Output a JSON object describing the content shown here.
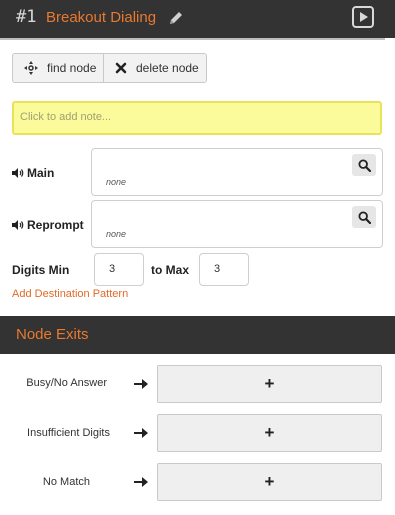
{
  "header": {
    "node_number": "#1",
    "node_title": "Breakout Dialing",
    "edit_icon": "pencil-icon",
    "play_icon": "play-icon"
  },
  "toolbar": {
    "find_label": "find node",
    "delete_label": "delete node",
    "find_icon": "crosshair-icon",
    "delete_icon": "x-icon"
  },
  "note": {
    "placeholder": "Click to add note..."
  },
  "prompts": {
    "main": {
      "label": "Main",
      "value": "none"
    },
    "reprompt": {
      "label": "Reprompt",
      "value": "none"
    }
  },
  "digits": {
    "min_label": "Digits Min",
    "min_value": "3",
    "max_label": "to Max",
    "max_value": "3",
    "add_pattern_label": "Add Destination Pattern"
  },
  "exits": {
    "title": "Node Exits",
    "items": [
      {
        "label": "Busy/No Answer",
        "action": "+"
      },
      {
        "label": "Insufficient Digits",
        "action": "+"
      },
      {
        "label": "No Match",
        "action": "+"
      }
    ]
  },
  "colors": {
    "accent": "#e8792f",
    "header_bg": "#333333",
    "note_bg": "#fbfb9c"
  }
}
